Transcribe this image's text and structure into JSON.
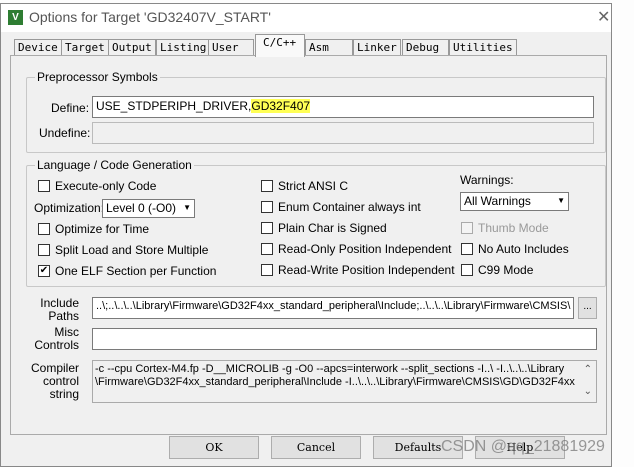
{
  "window": {
    "title": "Options for Target 'GD32407V_START'",
    "close_icon": "close-icon"
  },
  "tabs": [
    {
      "label": "Device"
    },
    {
      "label": "Target"
    },
    {
      "label": "Output"
    },
    {
      "label": "Listing"
    },
    {
      "label": "User"
    },
    {
      "label": "C/C++",
      "selected": true
    },
    {
      "label": "Asm"
    },
    {
      "label": "Linker"
    },
    {
      "label": "Debug"
    },
    {
      "label": "Utilities"
    }
  ],
  "preprocessor": {
    "title": "Preprocessor Symbols",
    "define_label": "Define:",
    "define_value_a": "USE_STDPERIPH_DRIVER,",
    "define_value_b": "GD32F407",
    "undefine_label": "Undefine:",
    "undefine_value": "",
    "highlight_color": "#ffff55"
  },
  "language": {
    "title": "Language / Code Generation",
    "col1": [
      {
        "label": "Execute-only Code",
        "checked": false
      },
      {
        "label": "Optimize for Time",
        "checked": false
      },
      {
        "label": "Split Load and Store Multiple",
        "checked": false
      },
      {
        "label": "One ELF Section per Function",
        "checked": true
      }
    ],
    "optimization_label": "Optimization:",
    "optimization_value": "Level 0 (-O0)",
    "col2": [
      {
        "label": "Strict ANSI C",
        "checked": false
      },
      {
        "label": "Enum Container always int",
        "checked": false
      },
      {
        "label": "Plain Char is Signed",
        "checked": false
      },
      {
        "label": "Read-Only Position Independent",
        "checked": false
      },
      {
        "label": "Read-Write Position Independent",
        "checked": false
      }
    ],
    "warnings_label": "Warnings:",
    "warnings_value": "All Warnings",
    "col3": [
      {
        "label": "Thumb Mode",
        "checked": false,
        "disabled": true
      },
      {
        "label": "No Auto Includes",
        "checked": false
      },
      {
        "label": "C99 Mode",
        "checked": false
      }
    ]
  },
  "include": {
    "label_1": "Include",
    "label_2": "Paths",
    "value": "..\\;..\\..\\..\\Library\\Firmware\\GD32F4xx_standard_peripheral\\Include;..\\..\\..\\Library\\Firmware\\CMSIS\\",
    "browse": "..."
  },
  "misc": {
    "label_1": "Misc",
    "label_2": "Controls",
    "value": ""
  },
  "compiler": {
    "label_1": "Compiler",
    "label_2": "control",
    "label_3": "string",
    "line1": "-c --cpu Cortex-M4.fp -D__MICROLIB -g -O0 --apcs=interwork --split_sections -I..\\ -I..\\..\\..\\Library",
    "line2": "\\Firmware\\GD32F4xx_standard_peripheral\\Include -I..\\..\\..\\Library\\Firmware\\CMSIS\\GD\\GD32F4xx"
  },
  "buttons": {
    "ok": "OK",
    "cancel": "Cancel",
    "defaults": "Defaults",
    "help": "Help"
  },
  "watermark": "CSDN @qq_21881929"
}
